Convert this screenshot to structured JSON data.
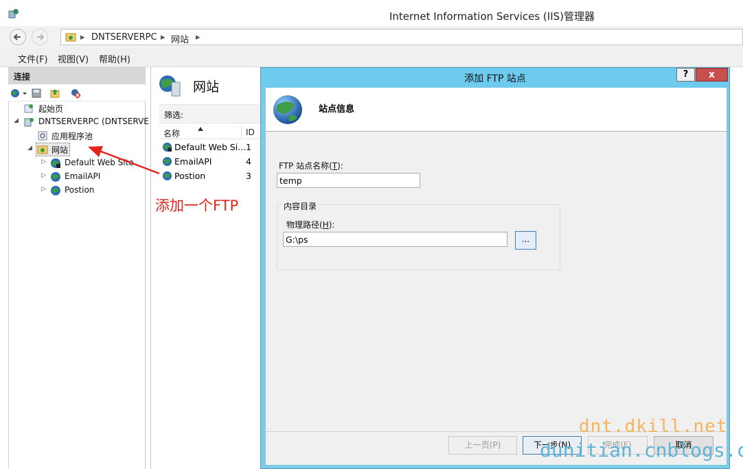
{
  "window": {
    "title": "Internet Information Services (IIS)管理器"
  },
  "address": {
    "crumbs": [
      "DNTSERVERPC",
      "网站"
    ],
    "separator": "▸"
  },
  "menu": {
    "items": [
      "文件(F)",
      "视图(V)",
      "帮助(H)"
    ]
  },
  "connections": {
    "header": "连接",
    "tree": {
      "start_page": "起始页",
      "server": "DNTSERVERPC (DNTSERVE",
      "app_pools": "应用程序池",
      "sites": "网站",
      "site_children": [
        "Default Web Site",
        "EmailAPI",
        "Postion"
      ]
    }
  },
  "middle": {
    "title": "网站",
    "filter_label": "筛选:",
    "columns": [
      "名称",
      "ID"
    ],
    "rows": [
      {
        "name": "Default Web Si...",
        "id": "1"
      },
      {
        "name": "EmailAPI",
        "id": "4"
      },
      {
        "name": "Postion",
        "id": "3"
      }
    ]
  },
  "dialog": {
    "title": "添加 FTP 站点",
    "help_label": "?",
    "close_label": "x",
    "header_text": "站点信息",
    "site_name_label": "FTP 站点名称",
    "site_name_hotkey": "T",
    "site_name_value": "temp",
    "content_group_label": "内容目录",
    "physical_path_label": "物理路径",
    "physical_path_hotkey": "H",
    "physical_path_value": "G:\\ps",
    "browse_label": "...",
    "buttons": {
      "prev": "上一页(P)",
      "next": "下一步(N)",
      "finish": "完成(F)",
      "cancel": "取消"
    }
  },
  "annotation": {
    "text": "添加一个FTP",
    "color": "#e2241a"
  },
  "watermarks": {
    "line1": "dnt.dkill.net",
    "line2": "dunitian.cnblogs.com"
  },
  "colors": {
    "dialog_frame": "#7ecbe8",
    "close_button": "#c7504e",
    "arrow": "#e2241a"
  }
}
